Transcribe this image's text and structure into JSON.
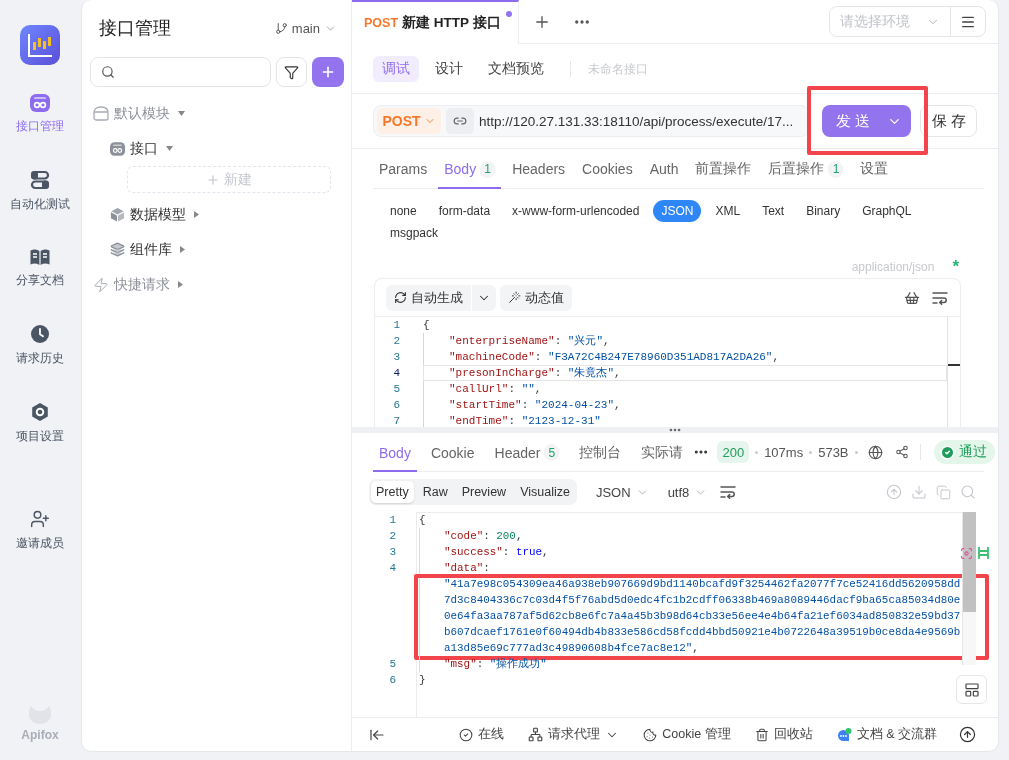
{
  "nav": {
    "items": [
      {
        "kind": "apis",
        "label": "接口管理",
        "selected": true
      },
      {
        "kind": "automation",
        "label": "自动化测试",
        "selected": false
      },
      {
        "kind": "docs",
        "label": "分享文档",
        "selected": false
      },
      {
        "kind": "history",
        "label": "请求历史",
        "selected": false
      },
      {
        "kind": "settings",
        "label": "项目设置",
        "selected": false
      }
    ],
    "invite": "邀请成员",
    "brand": "Apifox"
  },
  "sidebar": {
    "title": "接口管理",
    "branch": "main",
    "tree": [
      {
        "kind": "module",
        "label": "默认模块",
        "expanded": true,
        "children": [
          {
            "kind": "apis",
            "label": "接口",
            "expanded": true,
            "new_item": "新建"
          },
          {
            "kind": "schemas",
            "label": "数据模型",
            "expanded": false
          },
          {
            "kind": "components",
            "label": "组件库",
            "expanded": false
          }
        ]
      },
      {
        "kind": "quick",
        "label": "快捷请求",
        "expanded": false
      }
    ]
  },
  "tabs": [
    {
      "method": "POST",
      "title": "新建 HTTP 接口",
      "unsaved": true,
      "selected": true
    }
  ],
  "environment": {
    "placeholder": "请选择环境"
  },
  "modes": [
    {
      "label": "调试",
      "selected": true
    },
    {
      "label": "设计",
      "selected": false
    },
    {
      "label": "文档预览",
      "selected": false
    }
  ],
  "endpoint_name": {
    "placeholder": "未命名接口"
  },
  "request": {
    "method": "POST",
    "url": "http://120.27.131.33:18110/api/process/execute/17...",
    "send": {
      "label": "发 送",
      "highlighted": true
    },
    "save": "保 存"
  },
  "request_tabs": [
    {
      "label": "Params",
      "selected": false
    },
    {
      "label": "Body",
      "count": "1",
      "selected": true
    },
    {
      "label": "Headers",
      "selected": false
    },
    {
      "label": "Cookies",
      "selected": false
    },
    {
      "label": "Auth",
      "selected": false
    },
    {
      "label": "前置操作",
      "selected": false
    },
    {
      "label": "后置操作",
      "count": "1",
      "selected": false
    },
    {
      "label": "设置",
      "selected": false
    }
  ],
  "body_types": [
    {
      "label": "none",
      "selected": false
    },
    {
      "label": "form-data",
      "selected": false
    },
    {
      "label": "x-www-form-urlencoded",
      "selected": false
    },
    {
      "label": "JSON",
      "selected": true
    },
    {
      "label": "XML",
      "selected": false
    },
    {
      "label": "Text",
      "selected": false
    },
    {
      "label": "Binary",
      "selected": false
    },
    {
      "label": "GraphQL",
      "selected": false
    },
    {
      "label": "msgpack",
      "selected": false
    }
  ],
  "content_type": {
    "label": "application/json",
    "mark": "*"
  },
  "body_editor": {
    "auto_generate": "自动生成",
    "dynamic_value": "动态值",
    "lines": [
      {
        "number": "1",
        "kind": "bracket",
        "active": false,
        "tokens": [
          {
            "kind": "punct",
            "text": "{"
          }
        ]
      },
      {
        "number": "2",
        "kind": "member",
        "active": false,
        "tokens": [
          {
            "kind": "key",
            "text": "\"enterpriseName\""
          },
          {
            "kind": "punct",
            "text": ": "
          },
          {
            "kind": "string",
            "text": "\"兴元\""
          },
          {
            "kind": "punct",
            "text": ","
          }
        ]
      },
      {
        "number": "3",
        "kind": "member",
        "active": false,
        "tokens": [
          {
            "kind": "key",
            "text": "\"machineCode\""
          },
          {
            "kind": "punct",
            "text": ": "
          },
          {
            "kind": "string",
            "text": "\"F3A72C4B247E78960D351AD817A2DA26\""
          },
          {
            "kind": "punct",
            "text": ","
          }
        ]
      },
      {
        "number": "4",
        "kind": "member",
        "active": true,
        "tokens": [
          {
            "kind": "key",
            "text": "\"presonInCharge\""
          },
          {
            "kind": "punct",
            "text": ": "
          },
          {
            "kind": "string",
            "text": "\"朱竟杰\""
          },
          {
            "kind": "punct",
            "text": ","
          }
        ]
      },
      {
        "number": "5",
        "kind": "member",
        "active": false,
        "tokens": [
          {
            "kind": "key",
            "text": "\"callUrl\""
          },
          {
            "kind": "punct",
            "text": ": "
          },
          {
            "kind": "string",
            "text": "\"\""
          },
          {
            "kind": "punct",
            "text": ","
          }
        ]
      },
      {
        "number": "6",
        "kind": "member",
        "active": false,
        "tokens": [
          {
            "kind": "key",
            "text": "\"startTime\""
          },
          {
            "kind": "punct",
            "text": ": "
          },
          {
            "kind": "string",
            "text": "\"2024-04-23\""
          },
          {
            "kind": "punct",
            "text": ","
          }
        ]
      },
      {
        "number": "7",
        "kind": "member",
        "active": false,
        "tokens": [
          {
            "kind": "key",
            "text": "\"endTime\""
          },
          {
            "kind": "punct",
            "text": ": "
          },
          {
            "kind": "string",
            "text": "\"2123-12-31\""
          }
        ]
      }
    ]
  },
  "response": {
    "tabs": [
      {
        "label": "Body",
        "selected": true
      },
      {
        "label": "Cookie",
        "selected": false
      },
      {
        "label": "Header",
        "count": "5",
        "selected": false
      },
      {
        "label": "控制台",
        "selected": false
      },
      {
        "label": "实际请",
        "selected": false
      }
    ],
    "status": "200",
    "time": "107ms",
    "size": "573B",
    "result": "通过",
    "view_modes": [
      {
        "label": "Pretty",
        "selected": true
      },
      {
        "label": "Raw",
        "selected": false
      },
      {
        "label": "Preview",
        "selected": false
      },
      {
        "label": "Visualize",
        "selected": false
      }
    ],
    "format": "JSON",
    "encoding": "utf8",
    "lines": [
      {
        "number": "1",
        "kind": "bracket",
        "highlighted": false,
        "tokens": [
          {
            "kind": "punct",
            "text": "{"
          }
        ]
      },
      {
        "number": "2",
        "kind": "member",
        "highlighted": false,
        "tokens": [
          {
            "kind": "key",
            "text": "\"code\""
          },
          {
            "kind": "punct",
            "text": ": "
          },
          {
            "kind": "number",
            "text": "200"
          },
          {
            "kind": "punct",
            "text": ","
          }
        ]
      },
      {
        "number": "3",
        "kind": "member",
        "highlighted": false,
        "tokens": [
          {
            "kind": "key",
            "text": "\"success\""
          },
          {
            "kind": "punct",
            "text": ": "
          },
          {
            "kind": "boolean",
            "text": "true"
          },
          {
            "kind": "punct",
            "text": ","
          }
        ]
      },
      {
        "number": "4",
        "kind": "member",
        "highlighted": true,
        "tokens": [
          {
            "kind": "key",
            "text": "\"data\""
          },
          {
            "kind": "punct",
            "text": ": "
          },
          {
            "kind": "string",
            "text": "\"41a7e98c054309ea46a938eb907669d9bd1140bcafd9f3254462fa2077f7ce52416dd5620958dd7d3c8404336c7c03d4f5f76abd5d0edc4fc1b2cdff06338b469a8089446dacf9ba65ca85034d80e0e64fa3aa787af5d62cb8e6fc7a4a45b3b98d64cb33e56ee4e4b64fa21ef6034ad850832e59bd37b607dcaef1761e0f60494db4b833e586cd58fcdd4bbd50921e4b0722648a39519b0ce8da4e9569ba13d85e69c777ad3c49890608b4fce7ac8e12\""
          },
          {
            "kind": "punct",
            "text": ","
          }
        ]
      },
      {
        "number": "5",
        "kind": "member",
        "highlighted": false,
        "tokens": [
          {
            "kind": "key",
            "text": "\"msg\""
          },
          {
            "kind": "punct",
            "text": ": "
          },
          {
            "kind": "string",
            "text": "\"操作成功\""
          }
        ]
      },
      {
        "number": "6",
        "kind": "bracket",
        "highlighted": false,
        "tokens": [
          {
            "kind": "punct",
            "text": "}"
          }
        ]
      }
    ]
  },
  "status_bar": {
    "items": [
      {
        "kind": "online",
        "label": "在线",
        "dropdown": false
      },
      {
        "kind": "proxy",
        "label": "请求代理",
        "dropdown": true
      },
      {
        "kind": "cookie",
        "label": "Cookie 管理",
        "dropdown": false
      },
      {
        "kind": "trash",
        "label": "回收站",
        "dropdown": false
      },
      {
        "kind": "community",
        "label": "文档 & 交流群",
        "dropdown": false
      }
    ]
  }
}
